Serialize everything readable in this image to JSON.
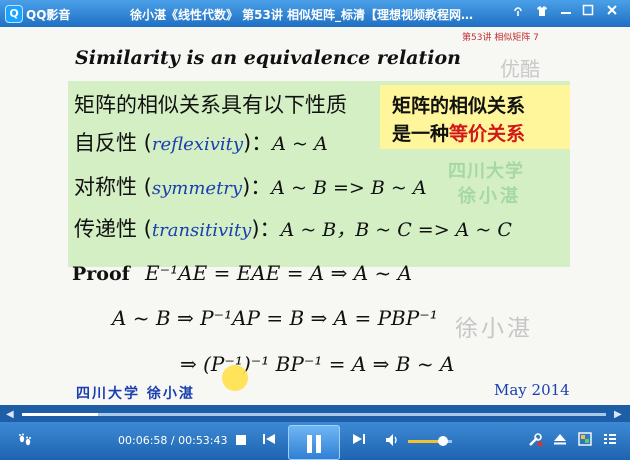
{
  "titlebar": {
    "app_name": "QQ影音",
    "window_title": "徐小湛《线性代数》 第53讲 相似矩阵_标清【理想视频教程网…"
  },
  "icons": {
    "app_logo": "qq-player-logo",
    "pin": "pin-icon",
    "skin": "skin-icon",
    "minimize": "minimize-icon",
    "maximize": "maximize-icon",
    "close": "close-icon"
  },
  "slide": {
    "heading": "Similarity is an equivalence relation",
    "slide_no": "第53讲  相似矩阵  7",
    "watermark_youku": "优酷",
    "property_title": "矩阵的相似关系具有以下性质",
    "reflexivity": {
      "zh": "自反性",
      "open": " (",
      "en": "reflexivity",
      "close": ")：",
      "math": "A ~ A"
    },
    "symmetry": {
      "zh": "对称性",
      "open": " (",
      "en": "symmetry",
      "close": ")：",
      "math": "A ~ B => B ~ A"
    },
    "transitivity": {
      "zh": "传递性",
      "open": " (",
      "en": "transitivity",
      "close": ")：",
      "math": "A ~ B，B ~ C  => A ~ C"
    },
    "callout_line1": "矩阵的相似关系",
    "callout_line2_prefix": "是一种",
    "callout_line2_red": "等价关系",
    "wm_school": "四川大学",
    "wm_name": "徐小湛",
    "proof_label": "Proof",
    "proof_line1": "E⁻¹AE  = EAE  = A  ⇒ A ~ A",
    "proof_line2": "A ~ B  ⇒ P⁻¹AP = B  ⇒ A = PBP⁻¹",
    "proof_line3": "⇒ (P⁻¹)⁻¹ BP⁻¹ = A  ⇒ B ~ A",
    "wm_signature": "徐小湛",
    "footer_school": "四川大学   徐小湛",
    "footer_date": "May 2014"
  },
  "player": {
    "current_time": "00:06:58",
    "separator": " / ",
    "total_time": "00:53:43",
    "progress_fraction": 0.13,
    "volume_fraction": 0.8,
    "accent_color": "#f2c230"
  },
  "controls": {
    "feet_icon": "footprint-icon",
    "stop_icon": "stop-icon",
    "prev_icon": "previous-icon",
    "pause_icon": "pause-icon",
    "next_icon": "next-icon",
    "volume_icon": "volume-icon",
    "tools_icon": "tools-icon",
    "eject_icon": "eject-icon",
    "screen_icon": "screen-icon",
    "list_icon": "playlist-icon"
  }
}
